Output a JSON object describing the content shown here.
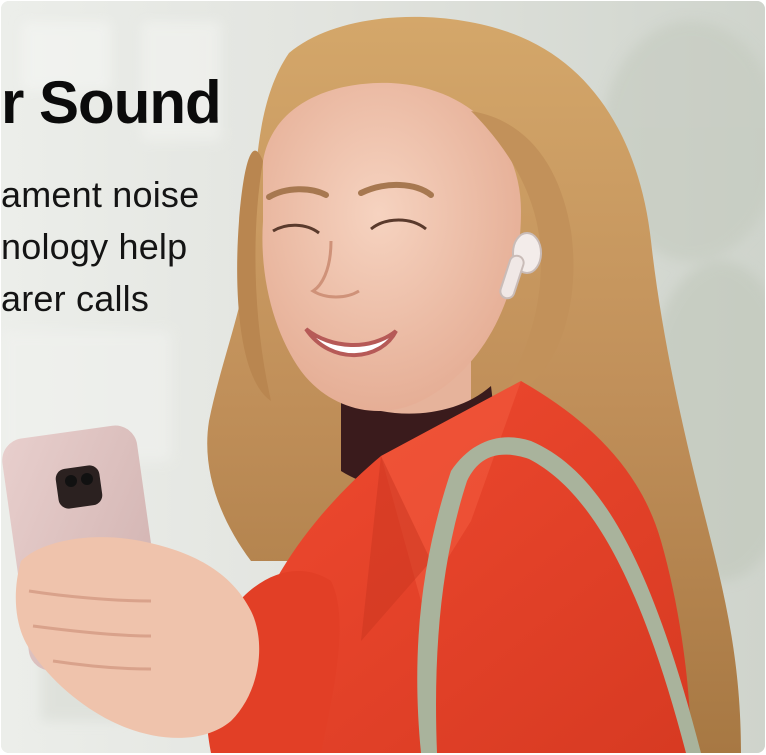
{
  "promo": {
    "headline": "r Sound",
    "body_lines": [
      "ament noise",
      "nology help",
      "arer calls"
    ]
  },
  "photo": {
    "subject": "woman-with-earbud-looking-at-phone",
    "colors": {
      "coat": "#e8402a",
      "hair": "#c99a5c",
      "phone": "#dcc0c0",
      "strap": "#a9b39c",
      "background": "#dfe1dc"
    }
  }
}
